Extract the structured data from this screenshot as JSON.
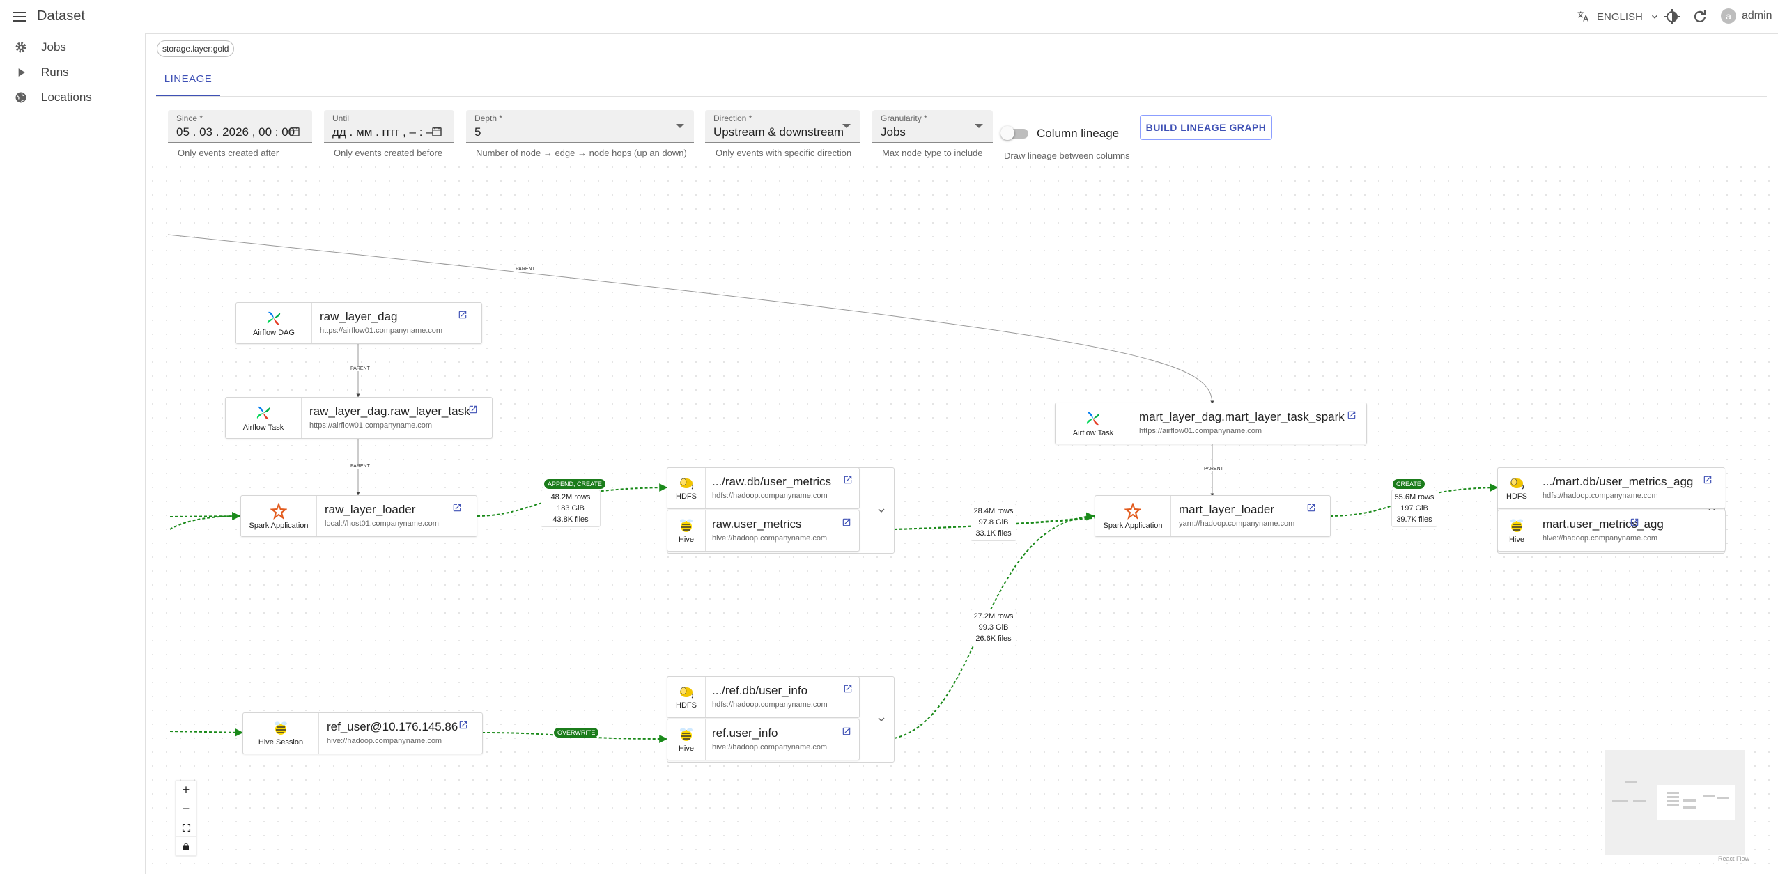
{
  "header": {
    "title": "Dataset",
    "language": "ENGLISH",
    "user": "admin",
    "avatar_letter": "a"
  },
  "sidebar": {
    "items": [
      {
        "label": "Jobs",
        "icon": "gear-icon"
      },
      {
        "label": "Runs",
        "icon": "play-icon"
      },
      {
        "label": "Locations",
        "icon": "globe-icon"
      }
    ]
  },
  "tag_chip": "storage.layer:gold",
  "tabs": [
    {
      "label": "LINEAGE",
      "active": true
    }
  ],
  "filters": {
    "since": {
      "label": "Since *",
      "value": "05 . 03 . 2026 ,  00 : 00",
      "helper": "Only events created after"
    },
    "until": {
      "label": "Until",
      "value": "дд . мм . гггг ,  – : –",
      "helper": "Only events created before"
    },
    "depth": {
      "label": "Depth *",
      "value": "5",
      "helper": "Number of node → edge → node hops (up an down)"
    },
    "direction": {
      "label": "Direction *",
      "value": "Upstream & downstream",
      "helper": "Only events with specific direction"
    },
    "granularity": {
      "label": "Granularity *",
      "value": "Jobs",
      "helper": "Max node type to include"
    },
    "column_lineage": {
      "label": "Column lineage",
      "helper": "Draw lineage between columns",
      "enabled": false
    },
    "build_button": "BUILD LINEAGE GRAPH"
  },
  "graph": {
    "nodes": {
      "raw_layer_dag": {
        "type": "Airflow DAG",
        "name": "raw_layer_dag",
        "url": "https://airflow01.companyname.com"
      },
      "raw_layer_task": {
        "type": "Airflow Task",
        "name": "raw_layer_dag.raw_layer_task",
        "url": "https://airflow01.companyname.com"
      },
      "raw_layer_loader": {
        "type": "Spark Application",
        "name": "raw_layer_loader",
        "url": "local://host01.companyname.com"
      },
      "raw_hdfs": {
        "type": "HDFS",
        "name": ".../raw.db/user_metrics",
        "url": "hdfs://hadoop.companyname.com"
      },
      "raw_hive": {
        "type": "Hive",
        "name": "raw.user_metrics",
        "url": "hive://hadoop.companyname.com"
      },
      "mart_task": {
        "type": "Airflow Task",
        "name": "mart_layer_dag.mart_layer_task_spark",
        "url": "https://airflow01.companyname.com"
      },
      "mart_loader": {
        "type": "Spark Application",
        "name": "mart_layer_loader",
        "url": "yarn://hadoop.companyname.com"
      },
      "mart_hdfs": {
        "type": "HDFS",
        "name": ".../mart.db/user_metrics_agg",
        "url": "hdfs://hadoop.companyname.com"
      },
      "mart_hive": {
        "type": "Hive",
        "name": "mart.user_metrics_agg",
        "url": "hive://hadoop.companyname.com"
      },
      "ref_session": {
        "type": "Hive Session",
        "name": "ref_user@10.176.145.86",
        "url": "hive://hadoop.companyname.com"
      },
      "ref_hdfs": {
        "type": "HDFS",
        "name": ".../ref.db/user_info",
        "url": "hdfs://hadoop.companyname.com"
      },
      "ref_hive": {
        "type": "Hive",
        "name": "ref.user_info",
        "url": "hive://hadoop.companyname.com"
      }
    },
    "edge_labels": {
      "parent": "PARENT"
    },
    "badges": {
      "append_create": "APPEND, CREATE",
      "create": "CREATE",
      "overwrite": "OVERWRITE"
    },
    "stats": {
      "raw_out": [
        "48.2M rows",
        "183 GiB",
        "43.8K files"
      ],
      "raw_to_mart": [
        "28.4M rows",
        "97.8 GiB",
        "33.1K files"
      ],
      "ref_to_mart": [
        "27.2M rows",
        "99.3 GiB",
        "26.6K files"
      ],
      "mart_out": [
        "55.6M rows",
        "197 GiB",
        "39.7K files"
      ]
    },
    "colors": {
      "lineage_edge": "#1a8a1a",
      "parent_edge": "#999999",
      "accent": "#3f51b5",
      "spark": "#e25a1c",
      "hadoop": "#f2c500"
    }
  },
  "attribution": "React Flow"
}
